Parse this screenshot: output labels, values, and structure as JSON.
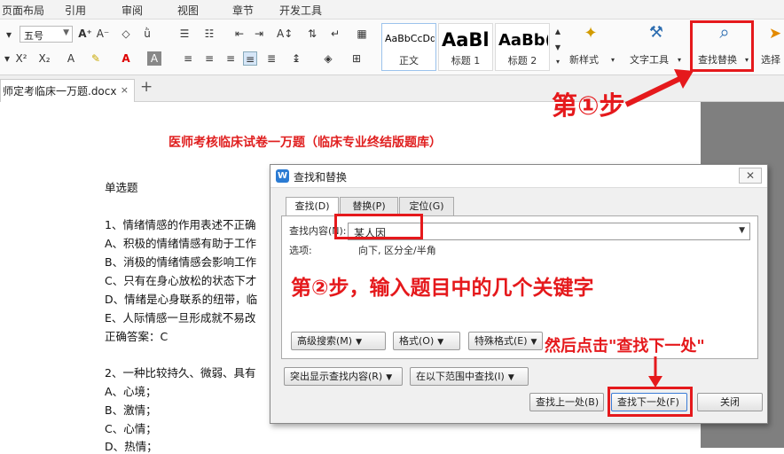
{
  "menu": [
    "页面布局",
    "引用",
    "审阅",
    "视图",
    "章节",
    "开发工具"
  ],
  "ribbon": {
    "font_size": "五号",
    "styles": [
      {
        "preview": "AaBbCcDd",
        "label": "正文"
      },
      {
        "preview": "AaBl",
        "label": "标题 1"
      },
      {
        "preview": "AaBb(",
        "label": "标题 2"
      }
    ],
    "new_style": "新样式",
    "text_tools": "文字工具",
    "find_replace": "查找替换",
    "select": "选择"
  },
  "tab": {
    "name": "师定考临床一万题.docx",
    "close": "×",
    "plus": "+"
  },
  "document": {
    "title": "医师考核临床试卷一万题（临床专业终结版题库）",
    "lines": [
      "单选题",
      "1、情绪情感的作用表述不正确",
      "A、积极的情绪情感有助于工作",
      "B、消极的情绪情感会影响工作",
      "C、只有在身心放松的状态下才",
      "D、情绪是心身联系的纽带，临",
      "E、人际情感一旦形成就不易改",
      "正确答案：C",
      "2、一种比较持久、微弱、具有",
      "A、心境；",
      "B、激情；",
      "C、心情；",
      "D、热情；"
    ]
  },
  "dialog": {
    "title": "查找和替换",
    "close": "✕",
    "tabs": [
      "查找(D)",
      "替换(P)",
      "定位(G)"
    ],
    "find_label": "查找内容(N):",
    "find_value": "某人因",
    "options_label": "选项:",
    "options_value": "向下, 区分全/半角",
    "buttons": {
      "advanced": "高级搜索(M)",
      "format": "格式(O)",
      "special": "特殊格式(E)",
      "highlight": "突出显示查找内容(R)",
      "scope": "在以下范围中查找(I)",
      "prev": "查找上一处(B)",
      "next": "查找下一处(F)",
      "close": "关闭"
    }
  },
  "annotations": {
    "step1": "第①步",
    "step2": "第②步，输入题目中的几个关键字",
    "step3": "然后点击\"查找下一处\""
  },
  "colors": {
    "annotation": "#e5191c",
    "title": "#e02020",
    "sidebar_gray": "#7f7f7f"
  }
}
